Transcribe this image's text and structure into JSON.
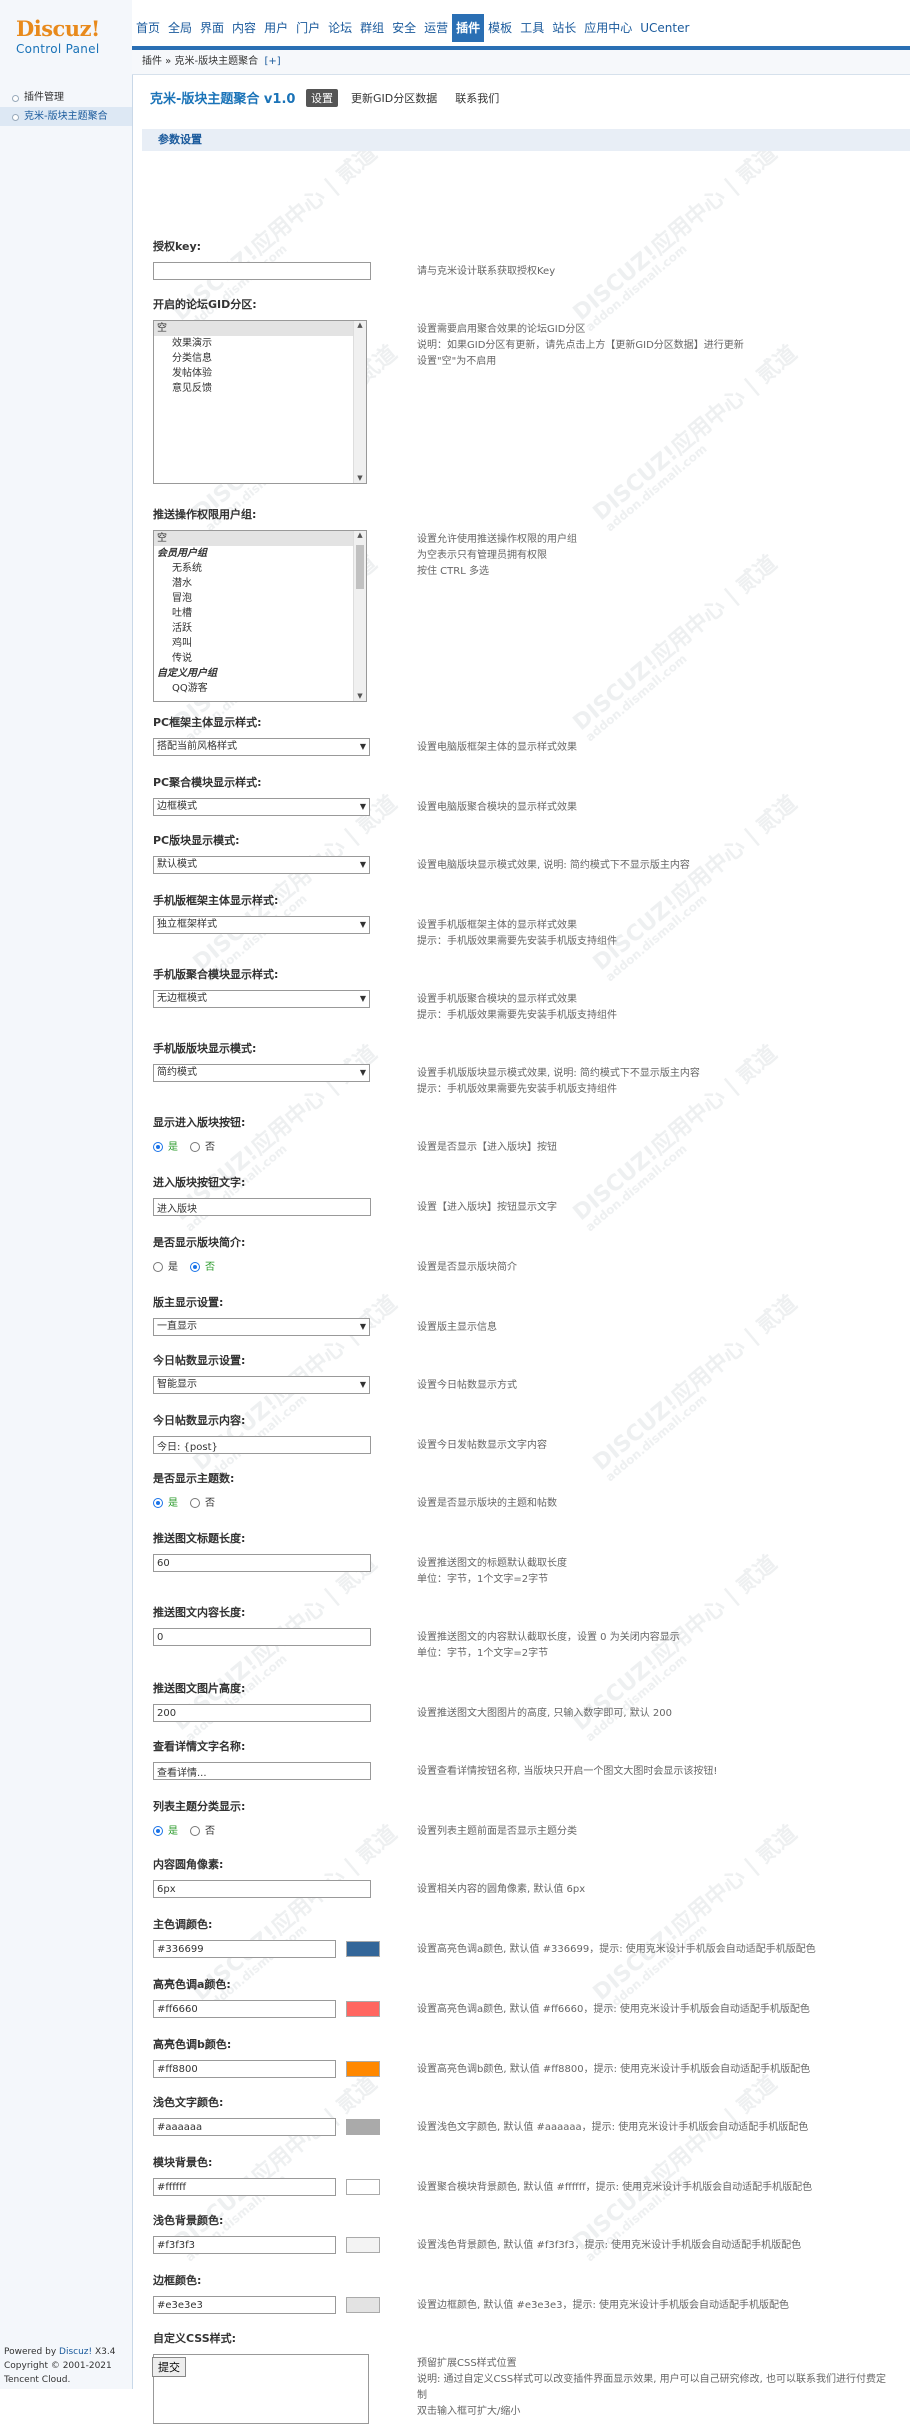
{
  "logo": {
    "name": "Discuz!",
    "sub": "Control Panel"
  },
  "nav": [
    "首页",
    "全局",
    "界面",
    "内容",
    "用户",
    "门户",
    "论坛",
    "群组",
    "安全",
    "运营",
    "插件",
    "模板",
    "工具",
    "站长",
    "应用中心",
    "UCenter"
  ],
  "nav_active": 10,
  "side": [
    {
      "label": "插件管理",
      "active": false
    },
    {
      "label": "克米-版块主题聚合",
      "active": true
    }
  ],
  "breadcrumb": {
    "root": "插件",
    "sep": " » ",
    "current": "克米-版块主题聚合",
    "add": "[+]"
  },
  "page": {
    "title": "克米-版块主题聚合 v1.0",
    "tabs": [
      {
        "label": "设置",
        "active": true
      },
      {
        "label": "更新GID分区数据",
        "active": false
      },
      {
        "label": "联系我们",
        "active": false
      }
    ],
    "section": "参数设置"
  },
  "watermark": {
    "a": "DISCUZ!应用中心 | 贰道",
    "b": "addon.dismall.com"
  },
  "fields": [
    {
      "id": "auth",
      "label": "授权key:",
      "type": "text",
      "value": "",
      "desc": [
        "请与克米设计联系获取授权Key"
      ]
    },
    {
      "id": "gid",
      "label": "开启的论坛GID分区:",
      "type": "multi",
      "h": 162,
      "options": [
        {
          "t": "空",
          "c": "sel1"
        },
        {
          "t": "效果演示",
          "c": "ind"
        },
        {
          "t": "分类信息",
          "c": "ind"
        },
        {
          "t": "发帖体验",
          "c": "ind"
        },
        {
          "t": "意见反馈",
          "c": "ind"
        }
      ],
      "desc": [
        "设置需要启用聚合效果的论坛GID分区",
        "说明：如果GID分区有更新，请先点击上方【更新GID分区数据】进行更新",
        "设置\"空\"为不启用"
      ]
    },
    {
      "id": "groups",
      "label": "推送操作权限用户组:",
      "type": "multi",
      "h": 170,
      "options": [
        {
          "t": "空",
          "c": "sel1"
        },
        {
          "t": "会员用户组",
          "c": "grp"
        },
        {
          "t": "无系统",
          "c": "ind"
        },
        {
          "t": "潜水",
          "c": "ind"
        },
        {
          "t": "冒泡",
          "c": "ind"
        },
        {
          "t": "吐槽",
          "c": "ind"
        },
        {
          "t": "活跃",
          "c": "ind"
        },
        {
          "t": "鸡叫",
          "c": "ind"
        },
        {
          "t": "传说",
          "c": "ind"
        },
        {
          "t": "自定义用户组",
          "c": "grp"
        },
        {
          "t": "QQ游客",
          "c": "ind"
        }
      ],
      "desc": [
        "设置允许使用推送操作权限的用户组",
        "为空表示只有管理员拥有权限",
        "按住 CTRL 多选"
      ]
    },
    {
      "id": "pc_frame",
      "label": "PC框架主体显示样式:",
      "type": "select",
      "value": "搭配当前风格样式",
      "desc": [
        "设置电脑版框架主体的显示样式效果"
      ]
    },
    {
      "id": "pc_agg",
      "label": "PC聚合模块显示样式:",
      "type": "select",
      "value": "边框模式",
      "desc": [
        "设置电脑版聚合模块的显示样式效果"
      ]
    },
    {
      "id": "pc_board",
      "label": "PC版块显示模式:",
      "type": "select",
      "value": "默认模式",
      "desc": [
        "设置电脑版块显示模式效果, 说明: 简约模式下不显示版主内容"
      ]
    },
    {
      "id": "m_frame",
      "label": "手机版框架主体显示样式:",
      "type": "select",
      "value": "独立框架样式",
      "desc": [
        "设置手机版框架主体的显示样式效果",
        "提示：手机版效果需要先安装手机版支持组件"
      ]
    },
    {
      "id": "m_agg",
      "label": "手机版聚合模块显示样式:",
      "type": "select",
      "value": "无边框模式",
      "desc": [
        "设置手机版聚合模块的显示样式效果",
        "提示：手机版效果需要先安装手机版支持组件"
      ]
    },
    {
      "id": "m_board",
      "label": "手机版版块显示模式:",
      "type": "select",
      "value": "简约模式",
      "desc": [
        "设置手机版版块显示模式效果, 说明: 简约模式下不显示版主内容",
        "提示：手机版效果需要先安装手机版支持组件"
      ]
    },
    {
      "id": "enter_btn",
      "label": "显示进入版块按钮:",
      "type": "radio",
      "options": [
        "是",
        "否"
      ],
      "selected": 0,
      "desc": [
        "设置是否显示【进入版块】按钮"
      ]
    },
    {
      "id": "enter_text",
      "label": "进入版块按钮文字:",
      "type": "text",
      "value": "进入版块",
      "desc": [
        "设置【进入版块】按钮显示文字"
      ]
    },
    {
      "id": "show_intro",
      "label": "是否显示版块简介:",
      "type": "radio",
      "options": [
        "是",
        "否"
      ],
      "selected": 1,
      "desc": [
        "设置是否显示版块简介"
      ]
    },
    {
      "id": "mod_show",
      "label": "版主显示设置:",
      "type": "select",
      "value": "一直显示",
      "desc": [
        "设置版主显示信息"
      ]
    },
    {
      "id": "today_set",
      "label": "今日帖数显示设置:",
      "type": "select",
      "value": "智能显示",
      "desc": [
        "设置今日帖数显示方式"
      ]
    },
    {
      "id": "today_text",
      "label": "今日帖数显示内容:",
      "type": "text",
      "value": "今日: {post}",
      "desc": [
        "设置今日发帖数显示文字内容"
      ]
    },
    {
      "id": "show_count",
      "label": "是否显示主题数:",
      "type": "radio",
      "options": [
        "是",
        "否"
      ],
      "selected": 0,
      "desc": [
        "设置是否显示版块的主题和帖数"
      ]
    },
    {
      "id": "title_len",
      "label": "推送图文标题长度:",
      "type": "text",
      "value": "60",
      "desc": [
        "设置推送图文的标题默认截取长度",
        "单位：字节，1个文字=2字节"
      ]
    },
    {
      "id": "content_len",
      "label": "推送图文内容长度:",
      "type": "text",
      "value": "0",
      "desc": [
        "设置推送图文的内容默认截取长度，设置 0 为关闭内容显示",
        "单位：字节，1个文字=2字节"
      ]
    },
    {
      "id": "img_h",
      "label": "推送图文图片高度:",
      "type": "text",
      "value": "200",
      "desc": [
        "设置推送图文大图图片的高度, 只输入数字即可, 默认 200"
      ]
    },
    {
      "id": "detail_name",
      "label": "查看详情文字名称:",
      "type": "text",
      "value": "查看详情...",
      "desc": [
        "设置查看详情按钮名称, 当版块只开启一个图文大图时会显示该按钮!"
      ]
    },
    {
      "id": "list_cat",
      "label": "列表主题分类显示:",
      "type": "radio",
      "options": [
        "是",
        "否"
      ],
      "selected": 0,
      "desc": [
        "设置列表主题前面是否显示主题分类"
      ]
    },
    {
      "id": "radius",
      "label": "内容圆角像素:",
      "type": "text",
      "value": "6px",
      "desc": [
        "设置相关内容的圆角像素, 默认值 6px"
      ]
    },
    {
      "id": "c_main",
      "label": "主色调颜色:",
      "type": "color",
      "value": "#336699",
      "color": "#336699",
      "desc": [
        "设置高亮色调a颜色, 默认值 #336699，提示: 使用克米设计手机版会自动适配手机版配色"
      ]
    },
    {
      "id": "c_a",
      "label": "高亮色调a颜色:",
      "type": "color",
      "value": "#ff6660",
      "color": "#ff6660",
      "desc": [
        "设置高亮色调a颜色, 默认值 #ff6660，提示: 使用克米设计手机版会自动适配手机版配色"
      ]
    },
    {
      "id": "c_b",
      "label": "高亮色调b颜色:",
      "type": "color",
      "value": "#ff8800",
      "color": "#ff8800",
      "desc": [
        "设置高亮色调b颜色, 默认值 #ff8800，提示: 使用克米设计手机版会自动适配手机版配色"
      ]
    },
    {
      "id": "c_light",
      "label": "浅色文字颜色:",
      "type": "color",
      "value": "#aaaaaa",
      "color": "#aaaaaa",
      "desc": [
        "设置浅色文字颜色, 默认值 #aaaaaa，提示: 使用克米设计手机版会自动适配手机版配色"
      ]
    },
    {
      "id": "c_bg",
      "label": "模块背景色:",
      "type": "color",
      "value": "#ffffff",
      "color": "#ffffff",
      "desc": [
        "设置聚合模块背景颜色, 默认值 #ffffff，提示: 使用克米设计手机版会自动适配手机版配色"
      ]
    },
    {
      "id": "c_lbg",
      "label": "浅色背景颜色:",
      "type": "color",
      "value": "#f3f3f3",
      "color": "#f3f3f3",
      "desc": [
        "设置浅色背景颜色, 默认值 #f3f3f3，提示: 使用克米设计手机版会自动适配手机版配色"
      ]
    },
    {
      "id": "c_border",
      "label": "边框颜色:",
      "type": "color",
      "value": "#e3e3e3",
      "color": "#e3e3e3",
      "desc": [
        "设置边框颜色, 默认值 #e3e3e3，提示: 使用克米设计手机版会自动适配手机版配色"
      ]
    },
    {
      "id": "css",
      "label": "自定义CSS样式:",
      "type": "textarea",
      "value": "",
      "desc": [
        "预留扩展CSS样式位置",
        "说明: 通过自定义CSS样式可以改变插件界面显示效果, 用户可以自己研究修改, 也可以联系我们进行付费定制",
        "双击输入框可扩大/缩小"
      ]
    }
  ],
  "submit": "提交",
  "footer": {
    "powered": "Powered by ",
    "brand": "Discuz!",
    "ver": " X3.4",
    "copy": "Copyright © 2001-2021",
    "company": "Tencent Cloud."
  }
}
